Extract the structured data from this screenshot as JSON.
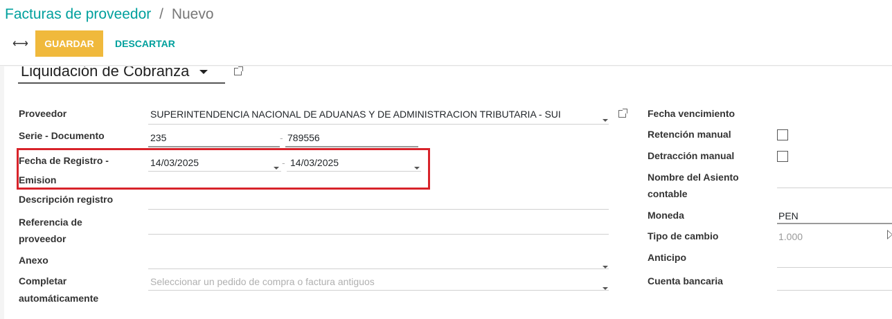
{
  "breadcrumb": {
    "parent": "Facturas de proveedor",
    "separator": "/",
    "current": "Nuevo"
  },
  "toolbar": {
    "toggle_icon": "⟷",
    "save_label": "GUARDAR",
    "discard_label": "DESCARTAR"
  },
  "journal": {
    "value": "Liquidación de Cobranza"
  },
  "left_fields": {
    "proveedor": {
      "label": "Proveedor",
      "value": "SUPERINTENDENCIA NACIONAL DE ADUANAS Y DE ADMINISTRACION TRIBUTARIA - SUI"
    },
    "serie": {
      "label": "Serie - Documento",
      "serie_value": "235",
      "separator": "-",
      "doc_value": "789556"
    },
    "fechas": {
      "label_line1": "Fecha de Registro -",
      "label_line2": "Emision",
      "registro_value": "14/03/2025",
      "separator": "-",
      "emision_value": "14/03/2025"
    },
    "descripcion": {
      "label": "Descripción registro",
      "value": ""
    },
    "referencia": {
      "label_line1": "Referencia de",
      "label_line2": "proveedor",
      "value": ""
    },
    "anexo": {
      "label": "Anexo",
      "value": ""
    },
    "completar": {
      "label_line1": "Completar",
      "label_line2": "automáticamente",
      "placeholder": "Seleccionar un pedido de compra o factura antiguos"
    }
  },
  "right_fields": {
    "fecha_vencimiento": {
      "label": "Fecha vencimiento"
    },
    "retencion": {
      "label": "Retención manual",
      "checked": false
    },
    "detraccion": {
      "label": "Detracción manual",
      "checked": false
    },
    "asiento": {
      "label_line1": "Nombre del Asiento",
      "label_line2": "contable",
      "value": ""
    },
    "moneda": {
      "label": "Moneda",
      "value": "PEN"
    },
    "tipo_cambio": {
      "label": "Tipo de cambio",
      "value": "1.000"
    },
    "anticipo": {
      "label": "Anticipo",
      "value": ""
    },
    "cuenta_bancaria": {
      "label": "Cuenta bancaria",
      "value": ""
    }
  },
  "colors": {
    "primary": "#00A09D",
    "save_button": "#F0B93C",
    "highlight": "#d8232a"
  }
}
